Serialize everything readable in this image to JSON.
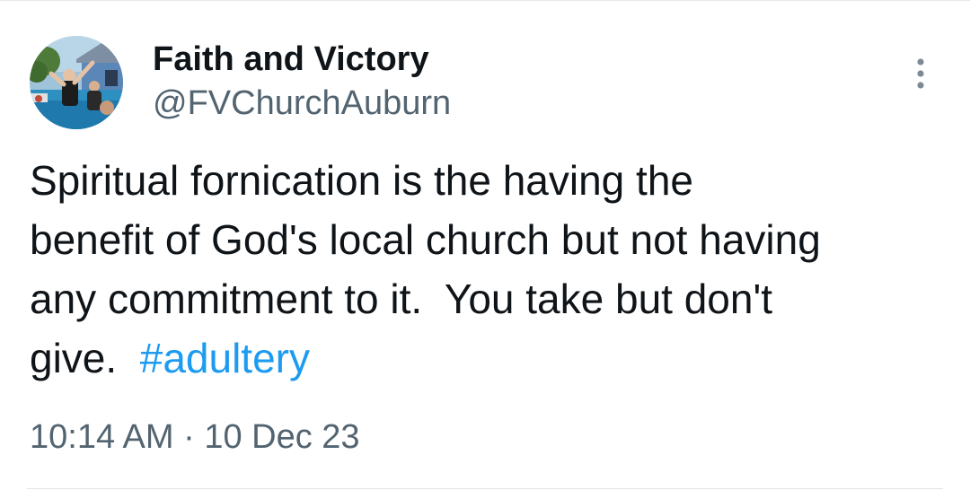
{
  "author": {
    "display_name": "Faith and Victory",
    "handle": "@FVChurchAuburn"
  },
  "tweet": {
    "text_lines": [
      "Spiritual fornication is the having the",
      "benefit of God's local church but not having",
      "any commitment to it.  You take but don't",
      "give.  "
    ],
    "hashtag": "#adultery"
  },
  "meta": {
    "time": "10:14 AM",
    "separator": " · ",
    "date": "10 Dec 23"
  },
  "icons": {
    "more": "more-vertical-icon"
  },
  "colors": {
    "hashtag": "#1d9bf0",
    "secondary_text": "#536471",
    "primary_text": "#0f1419"
  }
}
